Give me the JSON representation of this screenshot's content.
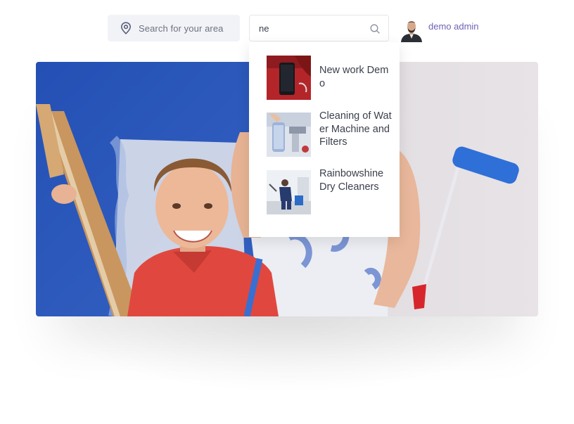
{
  "header": {
    "area_search": {
      "label": "Search for your area",
      "icon": "map-pin-icon"
    },
    "keyword_search": {
      "value": "ne",
      "icon": "search-icon"
    },
    "user": {
      "name": "demo admin",
      "avatar": "avatar"
    }
  },
  "search_results": [
    {
      "title": "New work Demo",
      "thumb": "phone-thumbnail"
    },
    {
      "title": "Cleaning of Water Machine and Filters",
      "thumb": "water-filter-thumbnail"
    },
    {
      "title": "Rainbowshine Dry Cleaners",
      "thumb": "cleaning-worker-thumbnail"
    }
  ],
  "colors": {
    "accent": "#6d63b5",
    "area_bg": "#f2f3f7",
    "hero_blue": "#2c55b8"
  }
}
